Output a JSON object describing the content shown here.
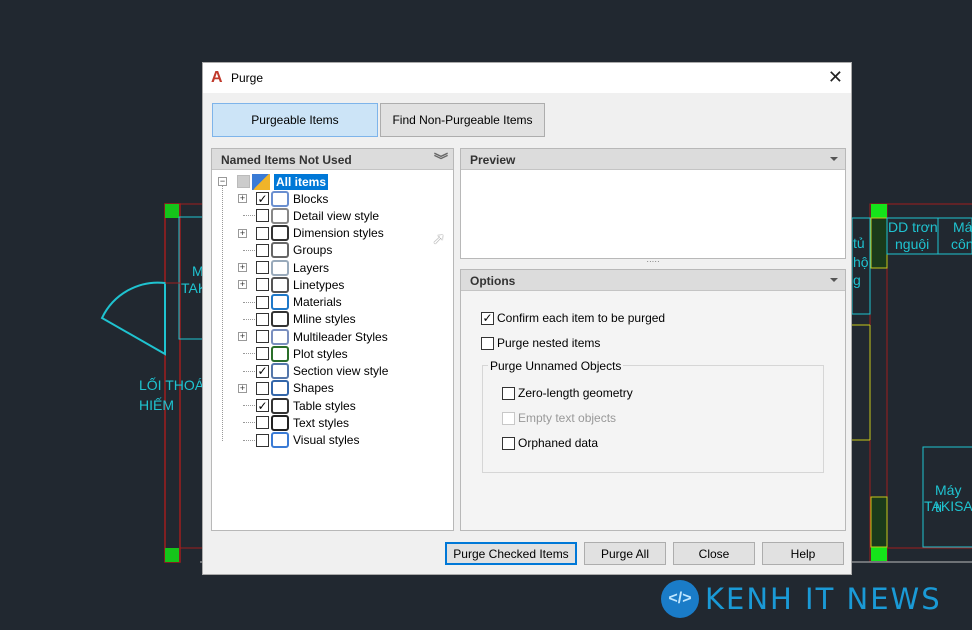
{
  "background": {
    "texts": [
      "M",
      "TAK",
      "LỐI THOÁ",
      "HIẾM",
      "tủ",
      "hộ",
      "g",
      "DD trơn",
      "nguội",
      "Má",
      "côn",
      "Máy ti",
      "TAKISA"
    ]
  },
  "watermark": {
    "brand": "KENH IT NEWS"
  },
  "dialog": {
    "title": "Purge",
    "close_label": "✕",
    "tabs": [
      {
        "label": "Purgeable Items",
        "active": true
      },
      {
        "label": "Find Non-Purgeable Items",
        "active": false
      }
    ],
    "tree": {
      "header": "Named Items Not Used",
      "root": "All items",
      "items": [
        {
          "label": "Blocks",
          "checked": true,
          "expandable": true,
          "icon": "blocks-icon"
        },
        {
          "label": "Detail view style",
          "checked": false,
          "expandable": false,
          "icon": "detail-view-icon"
        },
        {
          "label": "Dimension styles",
          "checked": false,
          "expandable": true,
          "icon": "dimension-icon"
        },
        {
          "label": "Groups",
          "checked": false,
          "expandable": false,
          "icon": "groups-icon"
        },
        {
          "label": "Layers",
          "checked": false,
          "expandable": true,
          "icon": "layers-icon"
        },
        {
          "label": "Linetypes",
          "checked": false,
          "expandable": true,
          "icon": "linetypes-icon"
        },
        {
          "label": "Materials",
          "checked": false,
          "expandable": false,
          "icon": "materials-icon"
        },
        {
          "label": "Mline styles",
          "checked": false,
          "expandable": false,
          "icon": "mline-icon"
        },
        {
          "label": "Multileader Styles",
          "checked": false,
          "expandable": true,
          "icon": "multileader-icon"
        },
        {
          "label": "Plot styles",
          "checked": false,
          "expandable": false,
          "icon": "plot-styles-icon"
        },
        {
          "label": "Section view style",
          "checked": true,
          "expandable": false,
          "icon": "section-view-icon"
        },
        {
          "label": "Shapes",
          "checked": false,
          "expandable": true,
          "icon": "shapes-icon"
        },
        {
          "label": "Table styles",
          "checked": true,
          "expandable": false,
          "icon": "table-icon"
        },
        {
          "label": "Text styles",
          "checked": false,
          "expandable": false,
          "icon": "text-styles-icon"
        },
        {
          "label": "Visual styles",
          "checked": false,
          "expandable": false,
          "icon": "visual-styles-icon"
        }
      ]
    },
    "preview": {
      "header": "Preview"
    },
    "options": {
      "header": "Options",
      "confirm": {
        "label": "Confirm each item to be purged",
        "checked": true
      },
      "nested": {
        "label": "Purge nested items",
        "checked": false
      },
      "group_label": "Purge Unnamed Objects",
      "zero_length": {
        "label": "Zero-length geometry",
        "checked": false
      },
      "empty_text": {
        "label": "Empty text objects",
        "checked": false,
        "disabled": true
      },
      "orphaned": {
        "label": "Orphaned data",
        "checked": false
      }
    },
    "buttons": {
      "purge_checked": "Purge Checked Items",
      "purge_all": "Purge All",
      "close": "Close",
      "help": "Help"
    }
  },
  "colors": {
    "cad_bg": "#212830",
    "cyan": "#1fc3d0",
    "accent": "#0078d7",
    "tab_active": "#cce4f7",
    "brand": "#1a9ad6"
  }
}
